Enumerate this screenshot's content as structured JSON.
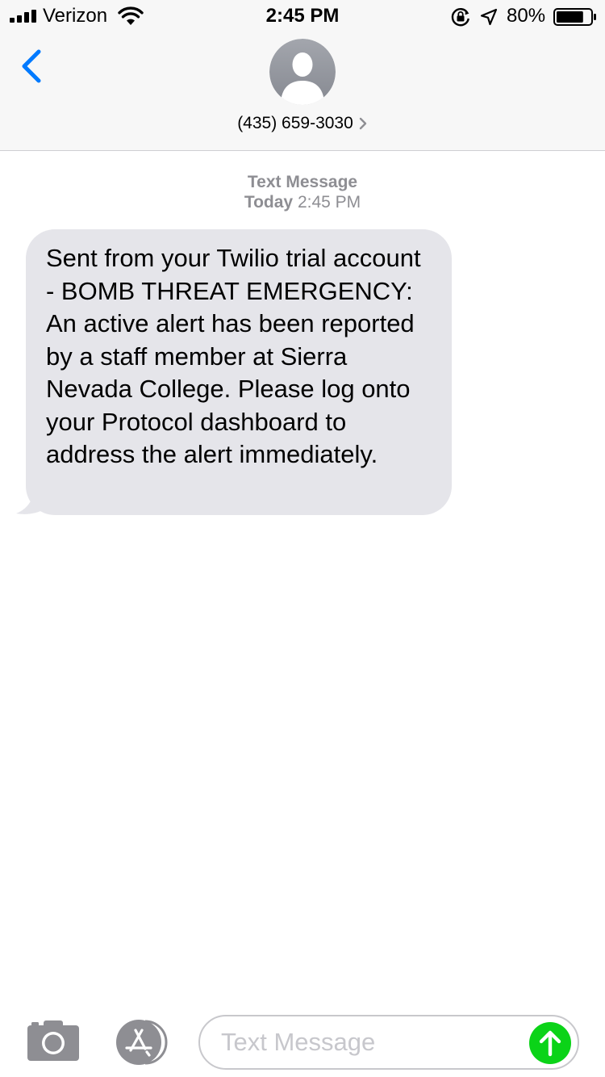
{
  "status_bar": {
    "carrier": "Verizon",
    "time": "2:45 PM",
    "battery_percent": "80%",
    "battery_level": 0.8,
    "icons": [
      "signal-icon",
      "wifi-icon",
      "orientation-lock-icon",
      "location-arrow-icon",
      "battery-icon"
    ]
  },
  "header": {
    "contact": "(435) 659-3030",
    "icons": [
      "back-chevron-icon",
      "contact-avatar-icon",
      "chevron-right-icon"
    ]
  },
  "conversation": {
    "service_label": "Text Message",
    "day_label": "Today",
    "time_label": "2:45 PM",
    "messages": [
      {
        "direction": "incoming",
        "text": "Sent from your Twilio trial account - BOMB THREAT EMERGENCY: An active alert has been reported by a staff member at Sierra Nevada College. Please log onto your Protocol dashboard to address the alert immediately."
      }
    ]
  },
  "composer": {
    "placeholder": "Text Message",
    "icons": [
      "camera-icon",
      "app-store-icon",
      "send-arrow-icon"
    ],
    "send_color": "#0bd318"
  },
  "colors": {
    "accent": "#007aff",
    "incoming_bubble": "#e5e5ea",
    "meta_text": "#8e8e93"
  }
}
